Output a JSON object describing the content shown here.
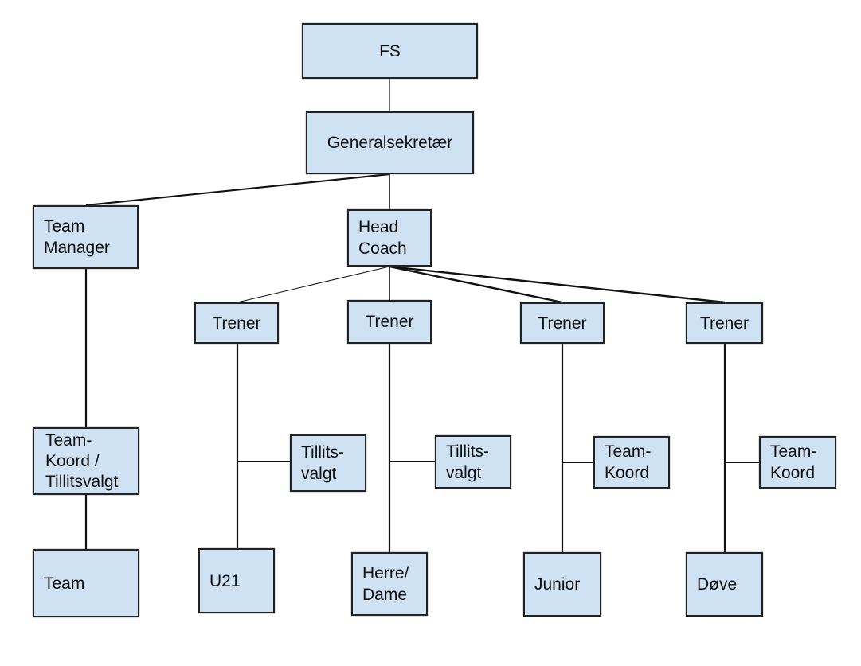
{
  "fill_color": "#cfe2f3",
  "nodes": {
    "fs": "FS",
    "gensek": "Generalsekretær",
    "team_manager": "Team\nManager",
    "head_coach": "Head\nCoach",
    "trener1": "Trener",
    "trener2": "Trener",
    "trener3": "Trener",
    "trener4": "Trener",
    "teamkoord_tillitsvalgt": "Team-\nKoord /\nTillitsvalgt",
    "team": "Team",
    "tillitsvalgt1": "Tillits-\nvalgt",
    "tillitsvalgt2": "Tillits-\nvalgt",
    "teamkoord3": "Team-\nKoord",
    "teamkoord4": "Team-\nKoord",
    "u21": "U21",
    "herre_dame": "Herre/\nDame",
    "junior": "Junior",
    "dove": "Døve"
  }
}
